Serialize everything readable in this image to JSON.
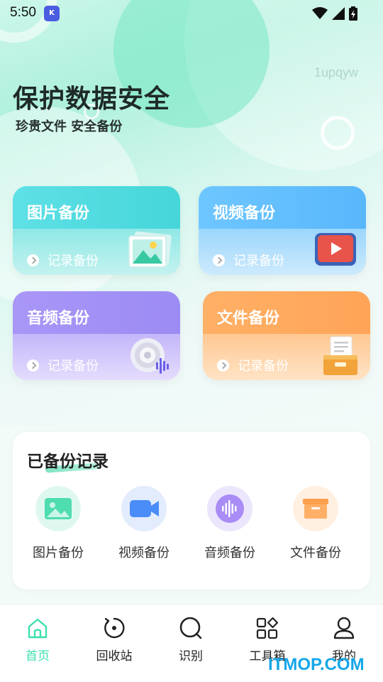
{
  "status_bar": {
    "time": "5:50"
  },
  "watermark": "1upqyw",
  "hero": {
    "title": "保护数据安全",
    "subtitle": "珍贵文件 安全备份"
  },
  "cards": [
    {
      "title": "图片备份",
      "record_label": "记录备份",
      "icon": "photo-icon"
    },
    {
      "title": "视频备份",
      "record_label": "记录备份",
      "icon": "play-icon"
    },
    {
      "title": "音频备份",
      "record_label": "记录备份",
      "icon": "speaker-icon"
    },
    {
      "title": "文件备份",
      "record_label": "记录备份",
      "icon": "file-box-icon"
    }
  ],
  "records": {
    "title": "已备份记录",
    "items": [
      {
        "label": "图片备份",
        "icon": "image-icon",
        "color": "#4fdcb0"
      },
      {
        "label": "视频备份",
        "icon": "video-camera-icon",
        "color": "#4b8df8"
      },
      {
        "label": "音频备份",
        "icon": "audio-wave-icon",
        "color": "#a98cf6"
      },
      {
        "label": "文件备份",
        "icon": "folder-box-icon",
        "color": "#ffa04e"
      }
    ]
  },
  "tabbar": {
    "tabs": [
      {
        "label": "首页",
        "icon": "home-icon",
        "active": true
      },
      {
        "label": "回收站",
        "icon": "recycle-icon",
        "active": false
      },
      {
        "label": "识别",
        "icon": "search-icon",
        "active": false
      },
      {
        "label": "工具箱",
        "icon": "grid-icon",
        "active": false
      },
      {
        "label": "我的",
        "icon": "user-icon",
        "active": false
      }
    ]
  },
  "brand_watermark": "ITMOP.COM",
  "colors": {
    "accent": "#3ddfb0"
  }
}
